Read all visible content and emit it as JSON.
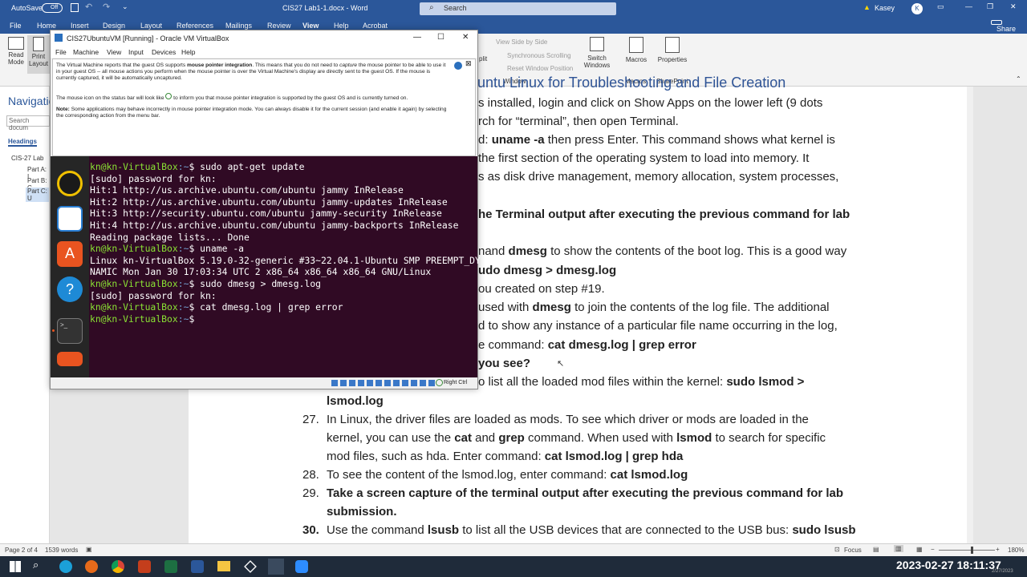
{
  "word": {
    "title_bar": {
      "autosave": "AutoSave",
      "autosave_state": "Off",
      "doc_title": "CIS27 Lab1-1.docx - Word",
      "search_placeholder": "Search",
      "user": "Kasey",
      "user_initial": "K"
    },
    "tabs": [
      "File",
      "Home",
      "Insert",
      "Design",
      "Layout",
      "References",
      "Mailings",
      "Review",
      "View",
      "Help",
      "Acrobat"
    ],
    "share": "Share",
    "ribbon": {
      "read_mode": "Read Mode",
      "print_layout": "Print Layout",
      "view_side_by_side": "View Side by Side",
      "synchronous_scrolling": "Synchronous Scrolling",
      "reset_window_position": "Reset Window Position",
      "switch_windows": "Switch Windows",
      "window_group": "Window",
      "macros": "Macros",
      "macros_group": "Macros",
      "properties": "Properties",
      "sharepoint_group": "SharePoint",
      "split": "plit"
    },
    "nav": {
      "title": "Navigatio",
      "search": "Search docum",
      "headings": "Headings",
      "items": [
        "CIS-27 Lab",
        "Part A: I",
        "Part B: C",
        "Part C: U"
      ]
    },
    "heading_partial": "untu Linux for Troubleshooting and File Creation",
    "lines": [
      {
        "text": "s installed, login and click on Show Apps on the lower left (9 dots"
      },
      {
        "text": "rch for “terminal”, then open Terminal."
      },
      {
        "pre": "d: ",
        "bold": "uname -a",
        "post": " then press Enter. This command shows what kernel is"
      },
      {
        "text": "the first section of the operating system to load into memory. It"
      },
      {
        "text": "s as disk drive management, memory allocation, system processes,"
      },
      {
        "bold": "he Terminal output after executing the previous command for lab"
      },
      {
        "pre": "nand ",
        "bold": "dmesg",
        "post": " to show the contents of the boot log. This is a good way"
      },
      {
        "bold": "udo dmesg > dmesg.log"
      },
      {
        "text": "ou created on step #19."
      },
      {
        "pre": "used with ",
        "bold": "dmesg",
        "post": " to join the contents of the log file. The additional"
      },
      {
        "text": "d to show any instance of a particular file name occurring in the log,"
      },
      {
        "pre": "e command: ",
        "bold": "cat dmesg.log | grep error"
      },
      {
        "bold": "you see?"
      },
      {
        "pre": "o list all the loaded mod files within the kernel: ",
        "bold": "sudo lsmod >"
      }
    ],
    "items": [
      {
        "num": "",
        "pre": "",
        "bold": "lsmod.log",
        "post": ""
      },
      {
        "num": "27.",
        "text": "In Linux, the driver files are loaded as mods. To see which driver or mods are loaded in the"
      },
      {
        "num": "",
        "pre": "kernel, you can use the ",
        "bold": "cat",
        "mid": " and ",
        "bold2": "grep",
        "mid2": " command. When used with ",
        "bold3": "lsmod",
        "post": " to search for specific"
      },
      {
        "num": "",
        "pre": "mod files, such as hda. Enter command: ",
        "bold": "cat lsmod.log | grep hda"
      },
      {
        "num": "28.",
        "pre": "To see the content of the lsmod.log, enter command: ",
        "bold": "cat lsmod.log"
      },
      {
        "num": "29.",
        "bold": "Take a screen capture of the terminal output after executing the previous command for lab"
      },
      {
        "num": "",
        "bold": "submission."
      },
      {
        "num": "30.",
        "pre": "Use the command ",
        "bold": "lsusb",
        "mid": " to list all the USB devices that are connected to the USB bus: ",
        "bold2": "sudo lsusb"
      }
    ],
    "status": {
      "page": "Page 2 of 4",
      "words": "1539 words",
      "focus": "Focus",
      "zoom": "180%"
    }
  },
  "vbox": {
    "title": "CIS27UbuntuVM [Running] - Oracle VM VirtualBox",
    "menu": [
      "File",
      "Machine",
      "View",
      "Input",
      "Devices",
      "Help"
    ],
    "notice": {
      "p1a": "The Virtual Machine reports that the guest OS supports ",
      "p1b": "mouse pointer integration",
      "p1c": ". This means that you do not need to ",
      "p1d": "capture",
      "p1e": " the mouse pointer to be able to use it in your guest OS -- all mouse actions you perform when the mouse pointer is over the Virtual Machine's display are directly sent to the guest OS. If the mouse is currently captured, it will be automatically uncaptured.",
      "p2a": "The mouse icon on the status bar will look like ",
      "p2b": " to inform you that mouse pointer integration is supported by the guest OS and is currently turned on.",
      "p3a": "Note:",
      "p3b": " Some applications may behave incorrectly in mouse pointer integration mode. You can always disable it for the current session (and enable it again) by selecting the corresponding action from the menu bar."
    },
    "terminal": [
      {
        "prompt": "kn@kn-VirtualBox",
        "path": ":~",
        "cmd": "$ sudo apt-get update"
      },
      {
        "out": "[sudo] password for kn:"
      },
      {
        "out": "Hit:1 http://us.archive.ubuntu.com/ubuntu jammy InRelease"
      },
      {
        "out": "Hit:2 http://us.archive.ubuntu.com/ubuntu jammy-updates InRelease"
      },
      {
        "out": "Hit:3 http://security.ubuntu.com/ubuntu jammy-security InRelease"
      },
      {
        "out": "Hit:4 http://us.archive.ubuntu.com/ubuntu jammy-backports InRelease"
      },
      {
        "out": "Reading package lists... Done"
      },
      {
        "prompt": "kn@kn-VirtualBox",
        "path": ":~",
        "cmd": "$ uname -a"
      },
      {
        "out": "Linux kn-VirtualBox 5.19.0-32-generic #33~22.04.1-Ubuntu SMP PREEMPT_DY"
      },
      {
        "out": "NAMIC Mon Jan 30 17:03:34 UTC 2 x86_64 x86_64 x86_64 GNU/Linux"
      },
      {
        "prompt": "kn@kn-VirtualBox",
        "path": ":~",
        "cmd": "$ sudo dmesg > dmesg.log"
      },
      {
        "out": "[sudo] password for kn:"
      },
      {
        "prompt": "kn@kn-VirtualBox",
        "path": ":~",
        "cmd": "$ cat dmesg.log | grep error"
      },
      {
        "prompt": "kn@kn-VirtualBox",
        "path": ":~",
        "cmd": "$ "
      }
    ],
    "host_key": "Right Ctrl"
  },
  "taskbar": {
    "datetime": "2023-02-27 18:11:37",
    "clock_small": "2/27/2023"
  }
}
